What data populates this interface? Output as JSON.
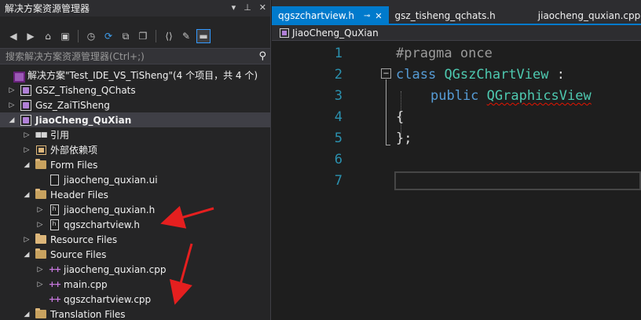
{
  "solution_explorer": {
    "title": "解决方案资源管理器",
    "title_controls": [
      "▾",
      "⊥",
      "✕"
    ],
    "search_placeholder": "搜索解决方案资源管理器(Ctrl+;)",
    "tree": [
      {
        "label": "解决方案\"Test_IDE_VS_TiSheng\"(4 个项目，共 4 个)",
        "icon": "solution-icon",
        "arrow": "",
        "indent": 0
      },
      {
        "label": "GSZ_Tisheng_QChats",
        "icon": "project-icon",
        "arrow": "▷",
        "indent": 0
      },
      {
        "label": "Gsz_ZaiTiSheng",
        "icon": "project-icon",
        "arrow": "▷",
        "indent": 0
      },
      {
        "label": "JiaoCheng_QuXian",
        "icon": "project-icon",
        "arrow": "◢",
        "indent": 0,
        "selected": true
      },
      {
        "label": "引用",
        "icon": "references-icon",
        "arrow": "▷",
        "indent": 1
      },
      {
        "label": "外部依赖项",
        "icon": "external-deps-icon",
        "arrow": "▷",
        "indent": 1
      },
      {
        "label": "Form Files",
        "icon": "folder-open-icon",
        "arrow": "◢",
        "indent": 1
      },
      {
        "label": "jiaocheng_quxian.ui",
        "icon": "ui-file-icon",
        "arrow": "",
        "indent": 2
      },
      {
        "label": "Header Files",
        "icon": "folder-open-icon",
        "arrow": "◢",
        "indent": 1
      },
      {
        "label": "jiaocheng_quxian.h",
        "icon": "header-file-icon",
        "arrow": "▷",
        "indent": 2
      },
      {
        "label": "qgszchartview.h",
        "icon": "header-file-icon",
        "arrow": "▷",
        "indent": 2
      },
      {
        "label": "Resource Files",
        "icon": "folder-icon",
        "arrow": "▷",
        "indent": 1
      },
      {
        "label": "Source Files",
        "icon": "folder-open-icon",
        "arrow": "◢",
        "indent": 1
      },
      {
        "label": "jiaocheng_quxian.cpp",
        "icon": "cpp-file-icon",
        "arrow": "▷",
        "indent": 2
      },
      {
        "label": "main.cpp",
        "icon": "cpp-file-icon",
        "arrow": "▷",
        "indent": 2
      },
      {
        "label": "qgszchartview.cpp",
        "icon": "cpp-file-icon",
        "arrow": "",
        "indent": 2
      },
      {
        "label": "Translation Files",
        "icon": "folder-open-icon",
        "arrow": "◢",
        "indent": 1
      }
    ]
  },
  "editor": {
    "tabs": [
      {
        "label": "qgszchartview.h",
        "active": true,
        "pin": "⊸",
        "close": "✕"
      },
      {
        "label": "gsz_tisheng_qchats.h",
        "active": false
      },
      {
        "label": "jiaocheng_quxian.cpp",
        "active": false
      }
    ],
    "nav_project": "JiaoCheng_QuXian",
    "line_numbers": [
      "1",
      "2",
      "3",
      "4",
      "5",
      "6",
      "7"
    ],
    "code": {
      "l1": "#pragma once",
      "l2_kw": "class",
      "l2_cls": "QGszChartView",
      "l2_rest": " :",
      "l3_kw": "public",
      "l3_cls": "QGraphicsView",
      "l4": "{",
      "l5": "};"
    }
  },
  "colors": {
    "accent": "#007acc",
    "annotation_arrow": "#e51f1f"
  }
}
